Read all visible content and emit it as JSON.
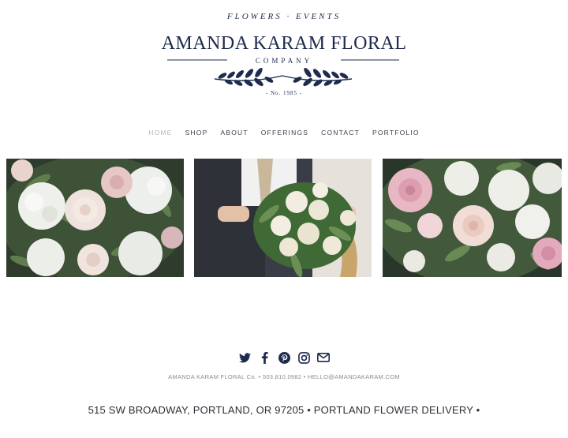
{
  "logo": {
    "tagline": "FLOWERS · EVENTS",
    "name": "AMANDA KARAM FLORAL",
    "company": "COMPANY",
    "established": "- No. 1985 -"
  },
  "nav": {
    "items": [
      {
        "label": "HOME",
        "active": true
      },
      {
        "label": "SHOP",
        "active": false
      },
      {
        "label": "ABOUT",
        "active": false
      },
      {
        "label": "OFFERINGS",
        "active": false
      },
      {
        "label": "CONTACT",
        "active": false
      },
      {
        "label": "PORTFOLIO",
        "active": false
      }
    ]
  },
  "gallery": {
    "photos": [
      {
        "name": "photo-blush-roses-hydrangeas"
      },
      {
        "name": "photo-bride-groom-bouquet"
      },
      {
        "name": "photo-pink-roses-greenery"
      }
    ]
  },
  "footer": {
    "social_icons": [
      "twitter-icon",
      "facebook-icon",
      "pinterest-icon",
      "instagram-icon",
      "mail-icon"
    ],
    "contact_line": "AMANDA KARAM FLORAL Co. • 503.810.0982 • HELLO@AMANDAKARAM.COM",
    "address": "515 SW BROADWAY, PORTLAND, OR 97205 • PORTLAND FLOWER DELIVERY •"
  },
  "colors": {
    "brand_navy": "#1e2a4e",
    "nav_text": "#3a3f4c",
    "nav_active": "#b3b6bd",
    "footer_text": "#888c94"
  }
}
